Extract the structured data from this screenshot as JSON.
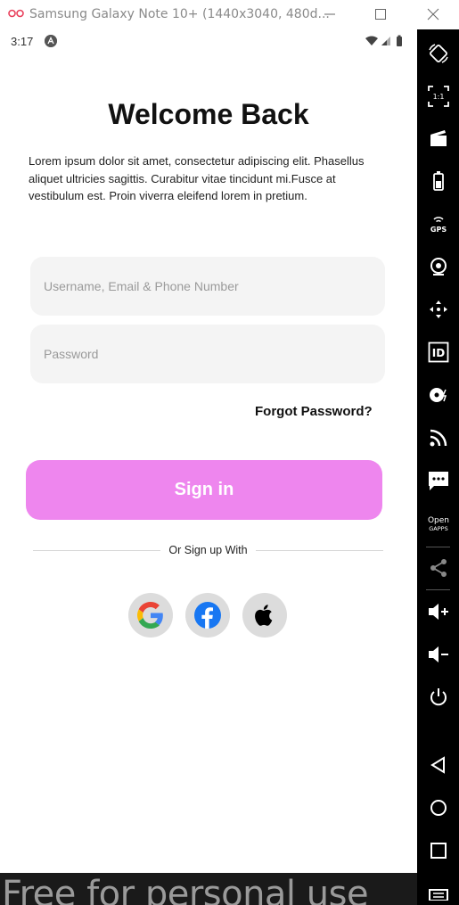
{
  "window": {
    "title": "Samsung Galaxy Note 10+ (1440x3040, 480d..."
  },
  "status_bar": {
    "time": "3:17",
    "badge_letter": "A"
  },
  "login": {
    "title": "Welcome Back",
    "description": "Lorem ipsum dolor sit amet, consectetur adipiscing elit. Phasellus aliquet ultricies sagittis. Curabitur vitae tincidunt mi.Fusce at vestibulum est. Proin viverra eleifend lorem in pretium.",
    "username_placeholder": "Username, Email & Phone Number",
    "username_value": "",
    "password_placeholder": "Password",
    "password_value": "",
    "forgot_label": "Forgot Password?",
    "signin_label": "Sign in",
    "divider_text": "Or Sign up With",
    "social": [
      {
        "name": "google",
        "icon": "google-icon"
      },
      {
        "name": "facebook",
        "icon": "facebook-icon"
      },
      {
        "name": "apple",
        "icon": "apple-icon"
      }
    ]
  },
  "colors": {
    "signin_bg": "#ee86ee",
    "field_bg": "#f4f4f4",
    "social_bg": "#dcdcdc",
    "facebook_blue": "#1877f2"
  },
  "emulator_toolbar": {
    "gps_label": "GPS",
    "id_label": "ID",
    "open_gapps_label_1": "Open",
    "open_gapps_label_2": "GAPPS",
    "fit_label": "1:1"
  },
  "watermark": "Free for personal use"
}
